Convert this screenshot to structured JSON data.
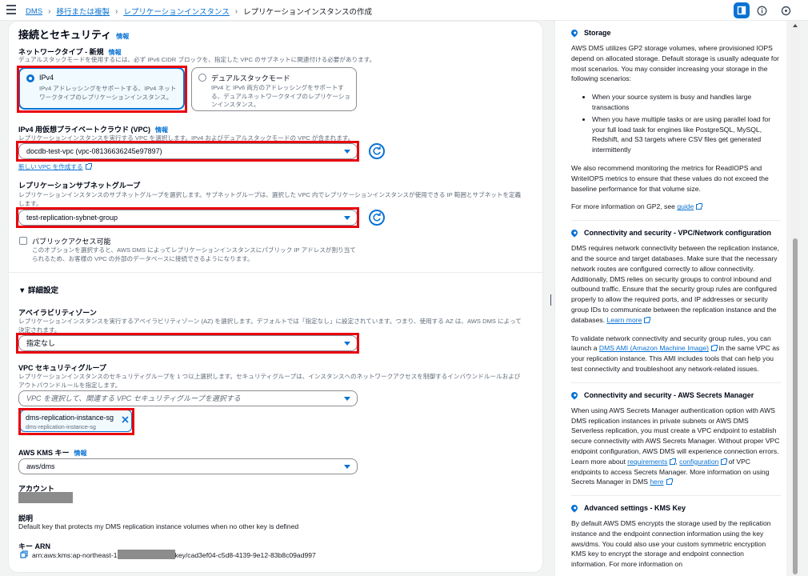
{
  "breadcrumbs": [
    {
      "label": "DMS"
    },
    {
      "label": "移行または複製"
    },
    {
      "label": "レプリケーションインスタンス"
    },
    {
      "label": "レプリケーションインスタンスの作成"
    }
  ],
  "section": {
    "title": "接続とセキュリティ",
    "info": "情報"
  },
  "network_type": {
    "label": "ネットワークタイプ - 新規",
    "info": "情報",
    "desc": "デュアルスタックモードを使用するには、必ず IPv6 CIDR ブロックを、指定した VPC のサブネットに関連付ける必要があります。",
    "ipv4_title": "IPv4",
    "ipv4_desc1": "IPv4 アドレッシングをサポートする、IPv4 ネット",
    "ipv4_desc2": "ワークタイプのレプリケーションインスタンス。",
    "dual_title": "デュアルスタックモード",
    "dual_desc1": "IPv4 と IPv6 両方のアドレッシングをサポートす",
    "dual_desc2": "る、デュアルネットワークタイプのレプリケーショ",
    "dual_desc3": "ンインスタンス。"
  },
  "vpc": {
    "label": "IPv4 用仮想プライベートクラウド (VPC)",
    "info": "情報",
    "desc": "レプリケーションインスタンスを実行する VPC を選択します。IPv4 およびデュアルスタックモードの VPC が含まれます。",
    "value": "docdb-test-vpc (vpc-08136636245e97897)",
    "create_link": "新しい VPC を作成する"
  },
  "subnet": {
    "label": "レプリケーションサブネットグループ",
    "desc1": "レプリケーションインスタンスのサブネットグループを選択します。サブネットグループは、選択した VPC 内でレプリケーションインスタンスが使用できる IP 範囲とサブネットを定義",
    "desc2": "します。",
    "value": "test-replication-sybnet-group"
  },
  "public_access": {
    "label": "パブリックアクセス可能",
    "desc1": "このオプションを選択すると、AWS DMS によってレプリケーションインスタンスにパブリック IP アドレスが割り当て",
    "desc2": "られるため、お客様の VPC の外部のデータベースに接続できるようになります。"
  },
  "advanced": {
    "title": "▼ 詳細設定"
  },
  "az": {
    "label": "アベイラビリティゾーン",
    "desc1": "レプリケーションインスタンスを実行するアベイラビリティゾーン (AZ) を選択します。デフォルトでは「指定なし」に設定されています。つまり、使用する AZ は、AWS DMS によって",
    "desc2": "決定されます。",
    "value": "指定なし"
  },
  "sg": {
    "label": "VPC セキュリティグループ",
    "desc1": "レプリケーションインスタンスのセキュリティグループを 1 つ以上選択します。セキュリティグループは、インスタンスへのネットワークアクセスを制御するインバウンドルールおよび",
    "desc2": "アウトバウンドルールを指定します。",
    "placeholder": "VPC を選択して、関連する VPC セキュリティグループを選択する",
    "token_name": "dms-replication-instance-sg",
    "token_sub": "dms-replication-instance-sg"
  },
  "kms": {
    "label": "AWS KMS キー",
    "info": "情報",
    "value": "aws/dms"
  },
  "account": {
    "label": "アカウント"
  },
  "description": {
    "label": "説明",
    "value": "Default key that protects my DMS replication instance volumes when no other key is defined"
  },
  "key_arn": {
    "label": "キー ARN",
    "prefix": "arn:aws:kms:ap-northeast-1",
    "suffix": "key/cad3ef04-c5d8-4139-9e12-83b8c09ad997"
  },
  "help": {
    "storage_title": "Storage",
    "storage_p1": "AWS DMS utilizes GP2 storage volumes, where provisioned IOPS depend on allocated storage. Default storage is usually adequate for most scenarios. You may consider increasing your storage in the following scenarios:",
    "storage_li1": "When your source system is busy and handles large transactions",
    "storage_li2": "When you have multiple tasks or are using parallel load for your full load task for engines like PostgreSQL, MySQL, Redshift, and S3 targets where CSV files get generated intermittently",
    "storage_p2": "We also recommend monitoring the metrics for ReadIOPS and WriteIOPS metrics to ensure that these values do not exceed the baseline performance for that volume size.",
    "storage_p3_pre": "For more information on GP2, see ",
    "storage_p3_link": "guide",
    "vpc_title": "Connectivity and security - VPC/Network configuration",
    "vpc_p1": "DMS requires network connectivity between the replication instance, and the source and target databases. Make sure that the necessary network routes are configured correctly to allow connectivity. Additionally, DMS relies on security groups to control inbound and outbound traffic. Ensure that the security group rules are configured properly to allow the required ports, and IP addresses or security group IDs to communicate between the replication instance and the databases. ",
    "vpc_p1_link": "Learn more",
    "vpc_p2_pre": "To validate network connectivity and security group rules, you can launch a ",
    "vpc_p2_link": "DMS AMI (Amazon Machine Image)",
    "vpc_p2_post": " in the same VPC as your replication instance. This AMI includes tools that can help you test connectivity and troubleshoot any network-related issues.",
    "sm_title": "Connectivity and security - AWS Secrets Manager",
    "sm_p1_pre": "When using AWS Secrets Manager authentication option with AWS DMS replication instances in private subnets or AWS DMS Serverless replication, you must create a VPC endpoint to establish secure connectivity with AWS Secrets Manager. Without proper VPC endpoint configuration, AWS DMS will experience connection errors. Learn more about ",
    "sm_link1": "requirements",
    "sm_mid": ", ",
    "sm_link2": "configuration",
    "sm_post": " of VPC endpoints to access Secrets Manager. More information on using Secrets Manager in DMS ",
    "sm_link3": "here",
    "kms_title": "Advanced settings - KMS Key",
    "kms_p1": "By default AWS DMS encrypts the storage used by the replication instance and the endpoint connection information using the key aws/dms. You could also use your custom symmetric encryption KMS key to encrypt the storage and endpoint connection information. For more information on"
  }
}
